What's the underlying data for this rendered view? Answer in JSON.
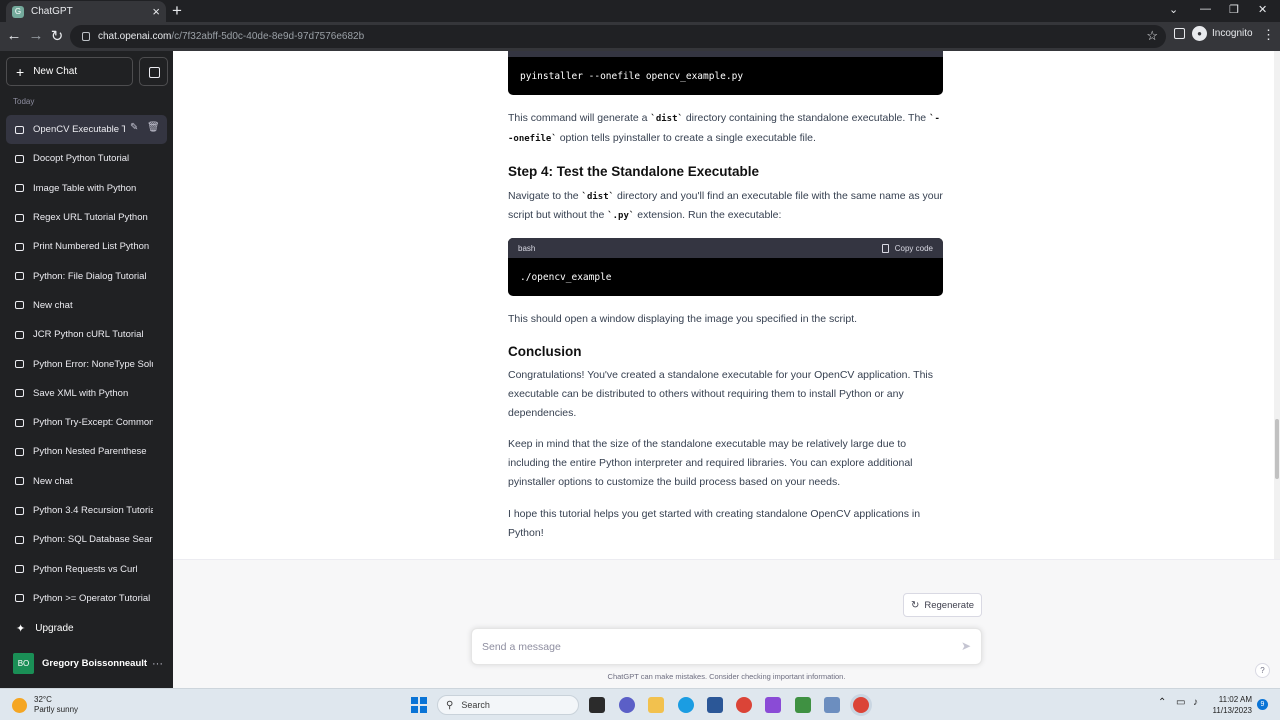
{
  "browser": {
    "tab_title": "ChatGPT",
    "tab_favicon": "G",
    "url_host": "chat.openai.com",
    "url_path": "/c/7f32abff-5d0c-40de-8e9d-97d7576e682b",
    "incognito_label": "Incognito"
  },
  "sidebar": {
    "new_chat_label": "New Chat",
    "section_today": "Today",
    "chats": [
      "OpenCV Executable T",
      "Docopt Python Tutorial",
      "Image Table with Python",
      "Regex URL Tutorial Python",
      "Print Numbered List Python",
      "Python: File Dialog Tutorial",
      "New chat",
      "JCR Python cURL Tutorial",
      "Python Error: NoneType Solu",
      "Save XML with Python",
      "Python Try-Except: Common",
      "Python Nested Parenthese",
      "New chat",
      "Python 3.4 Recursion Tutoria",
      "Python: SQL Database Searc",
      "Python Requests vs Curl",
      "Python >= Operator Tutorial"
    ],
    "upgrade_label": "Upgrade",
    "user_initials": "BO",
    "user_name": "Gregory Boissonneault"
  },
  "content": {
    "code1": "pyinstaller --onefile opencv_example.py",
    "p1_a": "This command will generate a ",
    "p1_code1": "`dist`",
    "p1_b": " directory containing the standalone executable. The ",
    "p1_code2": "`--onefile`",
    "p1_c": " option tells pyinstaller to create a single executable file.",
    "step4_heading": "Step 4: Test the Standalone Executable",
    "p2_a": "Navigate to the ",
    "p2_code1": "`dist`",
    "p2_b": " directory and you'll find an executable file with the same name as your script but without the ",
    "p2_code2": "`.py`",
    "p2_c": " extension. Run the executable:",
    "code2_lang": "bash",
    "code2_copy": "Copy code",
    "code2": "./opencv_example",
    "p3": "This should open a window displaying the image you specified in the script.",
    "conclusion_heading": "Conclusion",
    "p4": "Congratulations! You've created a standalone executable for your OpenCV application. This executable can be distributed to others without requiring them to install Python or any dependencies.",
    "p5": "Keep in mind that the size of the standalone executable may be relatively large due to including the entire Python interpreter and required libraries. You can explore additional pyinstaller options to customize the build process based on your needs.",
    "p6": "I hope this tutorial helps you get started with creating standalone OpenCV applications in Python!"
  },
  "composer": {
    "regenerate_label": "Regenerate",
    "placeholder": "Send a message",
    "disclaimer": "ChatGPT can make mistakes. Consider checking important information.",
    "help": "?"
  },
  "taskbar": {
    "temp": "32°C",
    "weather": "Partly sunny",
    "search_label": "Search",
    "time": "11:02 AM",
    "date": "11/13/2023",
    "notifications": "9"
  }
}
